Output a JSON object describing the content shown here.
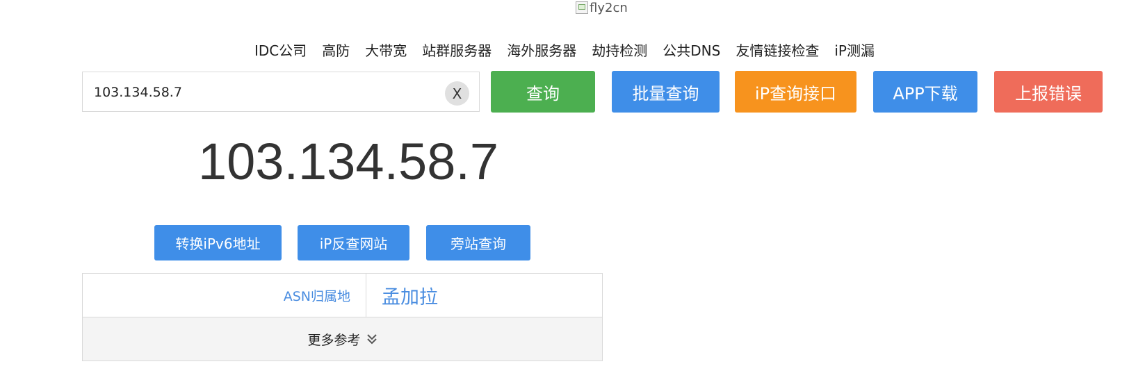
{
  "logo": {
    "alt": "fly2cn"
  },
  "nav": {
    "items": [
      "IDC公司",
      "高防",
      "大带宽",
      "站群服务器",
      "海外服务器",
      "劫持检测",
      "公共DNS",
      "友情链接检查",
      "iP测漏"
    ]
  },
  "search": {
    "value": "103.134.58.7",
    "clear_label": "X"
  },
  "actions": {
    "query": "查询",
    "batch": "批量查询",
    "api": "iP查询接口",
    "app": "APP下载",
    "report": "上报错误"
  },
  "result": {
    "ip": "103.134.58.7",
    "buttons": {
      "ipv6": "转换iPv6地址",
      "reverse": "iP反查网站",
      "sites": "旁站查询"
    },
    "asn_label": "ASN归属地",
    "asn_value": "孟加拉",
    "more": "更多参考"
  },
  "colors": {
    "green": "#4caf50",
    "blue": "#3f8ee8",
    "orange": "#f7931e",
    "red": "#ef6c5a",
    "link": "#4a8de0"
  },
  "icons": {
    "clear": "close-icon",
    "more": "double-chevron-down-icon",
    "logo": "broken-image-icon"
  }
}
